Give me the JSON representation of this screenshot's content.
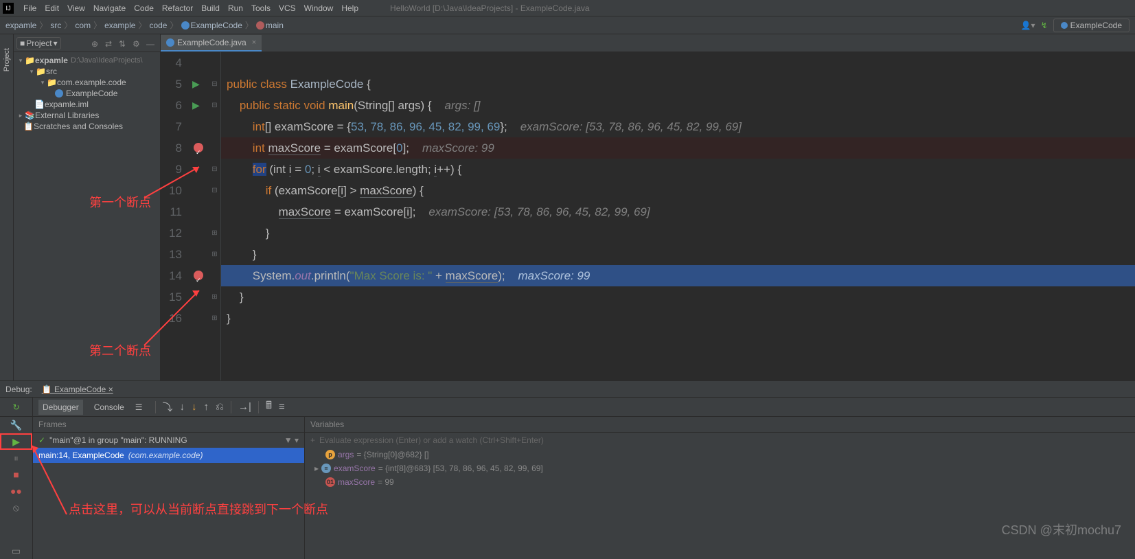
{
  "menu": [
    "File",
    "Edit",
    "View",
    "Navigate",
    "Code",
    "Refactor",
    "Build",
    "Run",
    "Tools",
    "VCS",
    "Window",
    "Help"
  ],
  "window_title": "HelloWorld [D:\\Java\\IdeaProjects] - ExampleCode.java",
  "breadcrumbs": [
    "expamle",
    "src",
    "com",
    "example",
    "code",
    "ExampleCode",
    "main"
  ],
  "run_config": "ExampleCode",
  "project": {
    "label": "Project",
    "root": "expamle",
    "root_path": "D:\\Java\\IdeaProjects\\",
    "nodes": {
      "src": "src",
      "pkg": "com.example.code",
      "cls": "ExampleCode",
      "iml": "expamle.iml",
      "ext": "External Libraries",
      "scratch": "Scratches and Consoles"
    }
  },
  "tab": {
    "name": "ExampleCode.java"
  },
  "code": {
    "lines": [
      4,
      5,
      6,
      7,
      8,
      9,
      10,
      11,
      12,
      13,
      14,
      15,
      16
    ],
    "l5": {
      "kw": "public class",
      "cls": "ExampleCode",
      "br": "{"
    },
    "l6": {
      "kw": "public static void",
      "mth": "main",
      "sig": "(String[] args) {",
      "hint": "args: []"
    },
    "l7": {
      "txt": "int[] examScore = {",
      "nums": "53, 78, 86, 96, 45, 82, 99, 69",
      "end": "};",
      "hint": "examScore: [53, 78, 86, 96, 45, 82, 99, 69]"
    },
    "l8": {
      "kw": "int",
      "var": "maxScore",
      "rest": " = examScore[",
      "idx": "0",
      "end": "];",
      "hint": "maxScore: 99"
    },
    "l9": {
      "kw": "for",
      "rest": " (int ",
      "v": "i",
      "eq": " = ",
      "z": "0",
      "cond": "; ",
      "v2": "i",
      "lt": " < examScore.",
      "len": "length",
      "inc": "; ",
      "v3": "i",
      "pp": "++) {"
    },
    "l10": {
      "kw": "if",
      "rest": " (examScore[",
      "v": "i",
      "gt": "] > ",
      "mx": "maxScore",
      "end": ") {"
    },
    "l11": {
      "mx": "maxScore",
      "rest": " = examScore[",
      "v": "i",
      "end": "];",
      "hint": "examScore: [53, 78, 86, 96, 45, 82, 99, 69]"
    },
    "l12": "}",
    "l13": "}",
    "l14": {
      "sys": "System.",
      "out": "out",
      "p": ".println(",
      "str": "\"Max Score is: \"",
      "plus": " + ",
      "mx": "maxScore",
      "end": ");",
      "hint": "maxScore: 99"
    },
    "l15": "}",
    "l16": "}"
  },
  "annotations": {
    "bp1": "第一个断点",
    "bp2": "第二个断点",
    "resume": "点击这里，可以从当前断点直接跳到下一个断点"
  },
  "debug": {
    "title": "Debug:",
    "config": "ExampleCode",
    "tabs": [
      "Debugger",
      "Console"
    ],
    "frames_label": "Frames",
    "vars_label": "Variables",
    "thread": "\"main\"@1 in group \"main\": RUNNING",
    "frame": {
      "loc": "main:14, ExampleCode ",
      "pkg": "(com.example.code)"
    },
    "eval_placeholder": "Evaluate expression (Enter) or add a watch (Ctrl+Shift+Enter)",
    "vars": {
      "args": {
        "name": "args",
        "val": " = {String[0]@682} []"
      },
      "examScore": {
        "name": "examScore",
        "val": " = {int[8]@683} [53, 78, 86, 96, 45, 82, 99, 69]"
      },
      "maxScore": {
        "name": "maxScore",
        "val": " = 99"
      }
    }
  },
  "watermark": "CSDN @末初mochu7"
}
